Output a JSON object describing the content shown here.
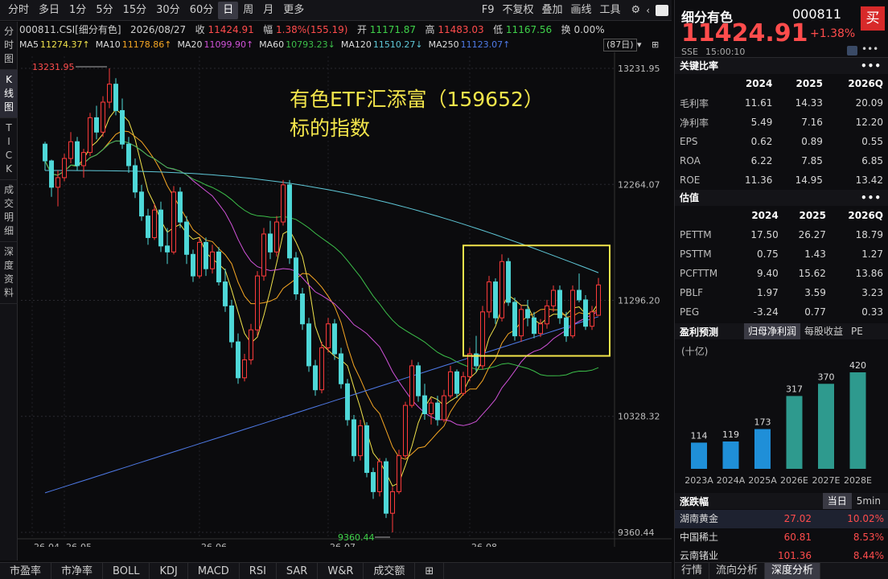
{
  "toolbar": {
    "periods": [
      "分时",
      "多日",
      "1分",
      "5分",
      "15分",
      "30分",
      "60分",
      "日",
      "周",
      "月",
      "更多"
    ],
    "active_period": "日",
    "right": [
      "F9",
      "不复权",
      "叠加",
      "画线",
      "工具"
    ]
  },
  "leftnav": [
    {
      "label": "分时图",
      "active": false
    },
    {
      "label": "K线图",
      "active": true
    },
    {
      "label": "TICK",
      "active": false
    },
    {
      "label": "成交明细",
      "active": false
    },
    {
      "label": "深度资料",
      "active": false
    }
  ],
  "info": {
    "code": "000811.CSI[细分有色]",
    "date": "2026/08/27",
    "close_label": "收",
    "close": "11424.91",
    "amp_label": "幅",
    "amp": "1.38%(155.19)",
    "open_label": "开",
    "open": "11171.87",
    "high_label": "高",
    "high": "11483.03",
    "low_label": "低",
    "low": "11167.56",
    "turn_label": "换",
    "turn": "0.00%"
  },
  "ma": [
    {
      "label": "MA5",
      "value": "11274.37↑",
      "color": "#f0e24b"
    },
    {
      "label": "MA10",
      "value": "11178.86↑",
      "color": "#f5a623"
    },
    {
      "label": "MA20",
      "value": "11099.90↑",
      "color": "#d052d8"
    },
    {
      "label": "MA60",
      "value": "10793.23↓",
      "color": "#3cbf4a"
    },
    {
      "label": "MA120",
      "value": "11510.27↓",
      "color": "#5fc8d8"
    },
    {
      "label": "MA250",
      "value": "11123.07↑",
      "color": "#4f7be8"
    }
  ],
  "count_label": "(87日)",
  "annotation": {
    "line1": "有色ETF汇添富（159652）",
    "line2": "标的指数"
  },
  "chart_data": {
    "type": "candlestick",
    "price_ticks": [
      "13231.95",
      "12264.07",
      "11296.20",
      "10328.32",
      "9360.44"
    ],
    "price_range": [
      9360.44,
      13231.95
    ],
    "date_ticks": [
      "26-04",
      "26-05",
      "26-06",
      "26-07",
      "26-08"
    ],
    "high_marker": "13231.95",
    "low_marker": "9360.44",
    "candles": [
      [
        12600,
        12620,
        12380,
        12460
      ],
      [
        12460,
        12470,
        12160,
        12240
      ],
      [
        12240,
        12380,
        12080,
        12320
      ],
      [
        12320,
        12520,
        12290,
        12480
      ],
      [
        12480,
        12700,
        12440,
        12620
      ],
      [
        12620,
        12660,
        12380,
        12420
      ],
      [
        12420,
        12560,
        12320,
        12530
      ],
      [
        12530,
        12860,
        12500,
        12820
      ],
      [
        12820,
        12920,
        12640,
        12700
      ],
      [
        12700,
        13000,
        12660,
        12950
      ],
      [
        12950,
        13231.95,
        12900,
        13100
      ],
      [
        13100,
        13150,
        12840,
        12880
      ],
      [
        12880,
        12980,
        12560,
        12600
      ],
      [
        12600,
        12660,
        12360,
        12420
      ],
      [
        12420,
        12480,
        12150,
        12200
      ],
      [
        12200,
        12260,
        11960,
        12000
      ],
      [
        12000,
        12060,
        11760,
        11820
      ],
      [
        11820,
        12100,
        11800,
        12050
      ],
      [
        12050,
        12120,
        11700,
        11750
      ],
      [
        11750,
        11900,
        11600,
        11700
      ],
      [
        11700,
        12250,
        11680,
        12200
      ],
      [
        12200,
        12240,
        11900,
        11950
      ],
      [
        11950,
        12000,
        11600,
        11680
      ],
      [
        11680,
        11720,
        11450,
        11500
      ],
      [
        11500,
        11820,
        11480,
        11780
      ],
      [
        11780,
        11820,
        11500,
        11560
      ],
      [
        11560,
        11760,
        11520,
        11700
      ],
      [
        11700,
        11740,
        11420,
        11450
      ],
      [
        11450,
        11560,
        11200,
        11250
      ],
      [
        11250,
        11300,
        10900,
        10950
      ],
      [
        10950,
        11020,
        10600,
        10650
      ],
      [
        10650,
        10850,
        10620,
        10800
      ],
      [
        10800,
        11100,
        10760,
        11050
      ],
      [
        11050,
        11540,
        11000,
        11500
      ],
      [
        11500,
        11900,
        11460,
        11850
      ],
      [
        11850,
        11960,
        11640,
        11700
      ],
      [
        11700,
        12000,
        11660,
        11950
      ],
      [
        11950,
        12300,
        11920,
        12260
      ],
      [
        12260,
        12300,
        11600,
        11650
      ],
      [
        11650,
        11700,
        11300,
        11350
      ],
      [
        11350,
        11400,
        11050,
        11100
      ],
      [
        11100,
        11150,
        10700,
        10750
      ],
      [
        10750,
        10800,
        10500,
        10550
      ],
      [
        10550,
        10950,
        10520,
        10900
      ],
      [
        10900,
        11150,
        10860,
        11100
      ],
      [
        11100,
        11140,
        10800,
        10850
      ],
      [
        10850,
        10900,
        10560,
        10600
      ],
      [
        10600,
        10640,
        10250,
        10300
      ],
      [
        10300,
        10340,
        9950,
        10000
      ],
      [
        10000,
        10300,
        9960,
        10250
      ],
      [
        10250,
        10280,
        9820,
        9860
      ],
      [
        9860,
        9900,
        9640,
        9700
      ],
      [
        9700,
        9980,
        9660,
        9950
      ],
      [
        9950,
        9980,
        9480,
        9520
      ],
      [
        9520,
        9740,
        9360.44,
        9700
      ],
      [
        9700,
        10050,
        9680,
        10000
      ],
      [
        10000,
        10450,
        9980,
        10420
      ],
      [
        10420,
        10800,
        10400,
        10750
      ],
      [
        10750,
        10780,
        10450,
        10500
      ],
      [
        10500,
        10600,
        10300,
        10350
      ],
      [
        10350,
        10480,
        10260,
        10440
      ],
      [
        10440,
        10500,
        10250,
        10300
      ],
      [
        10300,
        10550,
        10280,
        10500
      ],
      [
        10500,
        10750,
        10480,
        10700
      ],
      [
        10700,
        10720,
        10480,
        10520
      ],
      [
        10520,
        10700,
        10500,
        10660
      ],
      [
        10660,
        10900,
        10620,
        10850
      ],
      [
        10850,
        11000,
        10700,
        10750
      ],
      [
        10750,
        11250,
        10720,
        11200
      ],
      [
        11200,
        11500,
        11150,
        11450
      ],
      [
        11450,
        11480,
        11100,
        11150
      ],
      [
        11150,
        11680,
        11120,
        11620
      ],
      [
        11620,
        11650,
        11250,
        11280
      ],
      [
        11280,
        11320,
        10960,
        11000
      ],
      [
        11000,
        11260,
        10950,
        11220
      ],
      [
        11220,
        11300,
        11080,
        11150
      ],
      [
        11150,
        11200,
        10980,
        11020
      ],
      [
        11020,
        11140,
        10990,
        11100
      ],
      [
        11100,
        11300,
        11060,
        11250
      ],
      [
        11250,
        11420,
        11200,
        11380
      ],
      [
        11380,
        11420,
        11100,
        11150
      ],
      [
        11150,
        11200,
        10950,
        11000
      ],
      [
        11000,
        11420,
        10980,
        11380
      ],
      [
        11380,
        11520,
        11280,
        11300
      ],
      [
        11300,
        11340,
        11050,
        11080
      ],
      [
        11080,
        11250,
        11050,
        11200
      ],
      [
        11171.87,
        11483.03,
        11167.56,
        11424.91
      ]
    ]
  },
  "right": {
    "name": "细分有色",
    "code": "000811",
    "price": "11424.91",
    "change": "+1.38%",
    "buy": "买",
    "exchange": "SSE",
    "time": "15:00:10",
    "ratios": {
      "title": "关键比率",
      "years": [
        "2024",
        "2025",
        "2026Q"
      ],
      "rows": [
        {
          "label": "毛利率",
          "v": [
            "11.61",
            "14.33",
            "20.09"
          ]
        },
        {
          "label": "净利率",
          "v": [
            "5.49",
            "7.16",
            "12.20"
          ]
        },
        {
          "label": "EPS",
          "v": [
            "0.62",
            "0.89",
            "0.55"
          ]
        },
        {
          "label": "ROA",
          "v": [
            "6.22",
            "7.85",
            "6.85"
          ]
        },
        {
          "label": "ROE",
          "v": [
            "11.36",
            "14.95",
            "13.42"
          ]
        }
      ]
    },
    "valuation": {
      "title": "估值",
      "years": [
        "2024",
        "2025",
        "2026Q"
      ],
      "rows": [
        {
          "label": "PETTM",
          "v": [
            "17.50",
            "26.27",
            "18.79"
          ]
        },
        {
          "label": "PSTTM",
          "v": [
            "0.75",
            "1.43",
            "1.27"
          ]
        },
        {
          "label": "PCFTTM",
          "v": [
            "9.40",
            "15.62",
            "13.86"
          ]
        },
        {
          "label": "PBLF",
          "v": [
            "1.97",
            "3.59",
            "3.23"
          ]
        },
        {
          "label": "PEG",
          "v": [
            "-3.24",
            "0.77",
            "0.33"
          ]
        }
      ]
    },
    "forecast": {
      "title": "盈利预测",
      "tabs": [
        "归母净利润",
        "每股收益",
        "PE"
      ],
      "unit": "(十亿)",
      "chart_data": {
        "type": "bar",
        "categories": [
          "2023A",
          "2024A",
          "2025A",
          "2026E",
          "2027E",
          "2028E"
        ],
        "values": [
          114,
          119,
          173,
          317,
          370,
          420
        ]
      }
    },
    "movers": {
      "title": "涨跌幅",
      "tabs": [
        "当日",
        "5min"
      ],
      "rows": [
        {
          "name": "湖南黄金",
          "price": "27.02",
          "pct": "10.02%"
        },
        {
          "name": "中国稀土",
          "price": "60.81",
          "pct": "8.53%"
        },
        {
          "name": "云南锗业",
          "price": "101.36",
          "pct": "8.44%"
        }
      ]
    },
    "bottom_tabs": [
      "行情",
      "流向分析",
      "深度分析"
    ]
  },
  "bottom_tabs": [
    "市盈率",
    "市净率",
    "BOLL",
    "KDJ",
    "MACD",
    "RSI",
    "SAR",
    "W&R",
    "成交额"
  ]
}
